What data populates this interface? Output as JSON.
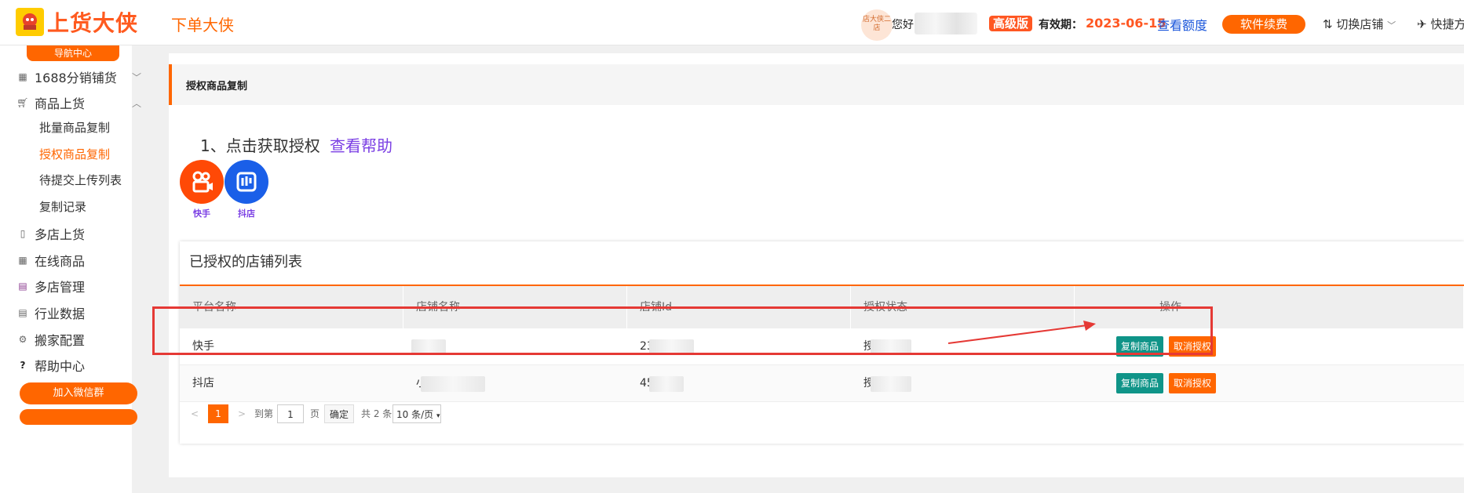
{
  "header": {
    "logo_text": "上货大侠",
    "app_name": "下单大侠",
    "shop_avatar_text": "店大侠二店",
    "greeting": "您好",
    "plan_badge": "高级版",
    "validity_label": "有效期：",
    "validity_date": "2023-06-15",
    "quota_link": "查看额度",
    "renew_button": "软件续费",
    "switch_shop": "切换店铺",
    "shortcut": "快捷方"
  },
  "sidebar": {
    "nav_center": "导航中心",
    "items": [
      {
        "label": "1688分销铺货",
        "icon": "grid-icon"
      },
      {
        "label": "商品上货",
        "icon": "cart-icon"
      },
      {
        "label": "多店上货",
        "icon": "document-icon"
      },
      {
        "label": "在线商品",
        "icon": "table-icon"
      },
      {
        "label": "多店管理",
        "icon": "store-grid-icon"
      },
      {
        "label": "行业数据",
        "icon": "clipboard-icon"
      },
      {
        "label": "搬家配置",
        "icon": "gear-icon"
      },
      {
        "label": "帮助中心",
        "icon": "question-icon"
      }
    ],
    "sub_items": [
      "批量商品复制",
      "授权商品复制",
      "待提交上传列表",
      "复制记录"
    ],
    "wechat_button": "加入微信群"
  },
  "main": {
    "page_title": "授权商品复制",
    "step_text": "1、点击获取授权",
    "help_link": "查看帮助",
    "platforms": [
      {
        "label": "快手",
        "color": "#ff4906"
      },
      {
        "label": "抖店",
        "color": "#1a5fe8"
      }
    ],
    "table": {
      "title": "已授权的店铺列表",
      "columns": [
        "平台名称",
        "店铺名称",
        "店铺Id",
        "授权状态",
        "操作"
      ],
      "rows": [
        {
          "platform": "快手",
          "shop_name": "",
          "shop_id": "23",
          "status": "授权"
        },
        {
          "platform": "抖店",
          "shop_name": "小",
          "shop_id": "45",
          "status": "授"
        }
      ],
      "copy_button": "复制商品",
      "cancel_button": "取消授权"
    },
    "pagination": {
      "prev": "<",
      "current": "1",
      "next": ">",
      "goto_label": "到第",
      "page_input": "1",
      "page_unit": "页",
      "confirm": "确定",
      "total": "共 2 条",
      "page_size": "10 条/页"
    }
  },
  "colors": {
    "accent": "#ff6600",
    "teal": "#0f9488",
    "highlight": "#e53935"
  }
}
